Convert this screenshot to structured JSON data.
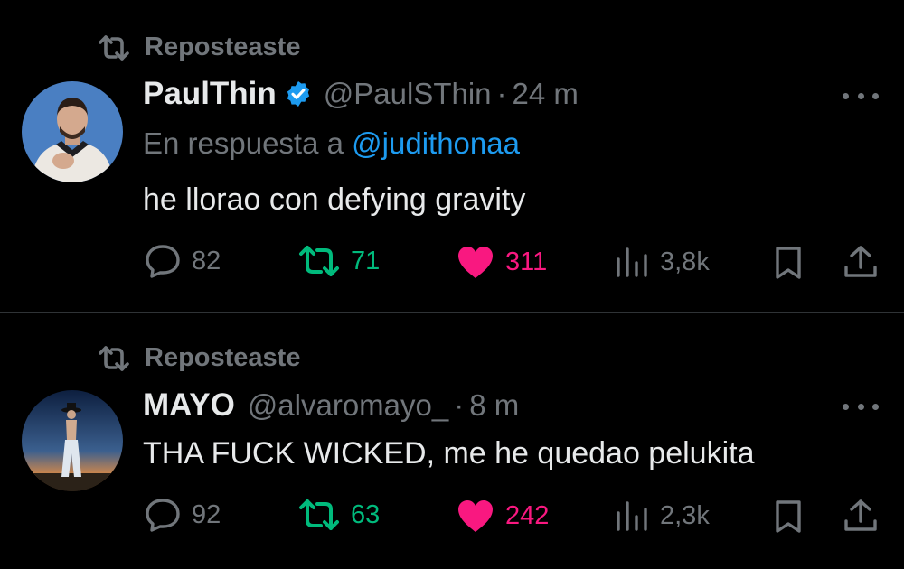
{
  "tweets": [
    {
      "repost_label": "Reposteaste",
      "name": "PaulThin",
      "verified": true,
      "handle": "@PaulSThin",
      "separator": "·",
      "time": "24 m",
      "reply_prefix": "En respuesta a",
      "reply_mention": "@judithonaa",
      "text": "he llorao con defying gravity",
      "replies": "82",
      "reposts": "71",
      "likes": "311",
      "views": "3,8k",
      "reposted_by_me": true,
      "liked_by_me": true
    },
    {
      "repost_label": "Reposteaste",
      "name": "MAYO",
      "verified": false,
      "handle": "@alvaromayo_",
      "separator": "·",
      "time": "8 m",
      "text": "THA FUCK WICKED, me he quedao pelukita",
      "replies": "92",
      "reposts": "63",
      "likes": "242",
      "views": "2,3k",
      "reposted_by_me": true,
      "liked_by_me": true
    }
  ],
  "colors": {
    "background": "#000000",
    "text": "#e7e9ea",
    "muted": "#71767b",
    "link": "#1d9bf0",
    "repost_active": "#00ba7c",
    "like_active": "#f91880",
    "divider": "#2f3336"
  },
  "icons": {
    "repost_header": "repost-icon",
    "verified": "verified-badge-icon",
    "more": "more-options-icon",
    "reply": "reply-icon",
    "repost": "repost-icon",
    "like": "heart-icon",
    "views": "views-chart-icon",
    "bookmark": "bookmark-icon",
    "share": "share-icon"
  }
}
